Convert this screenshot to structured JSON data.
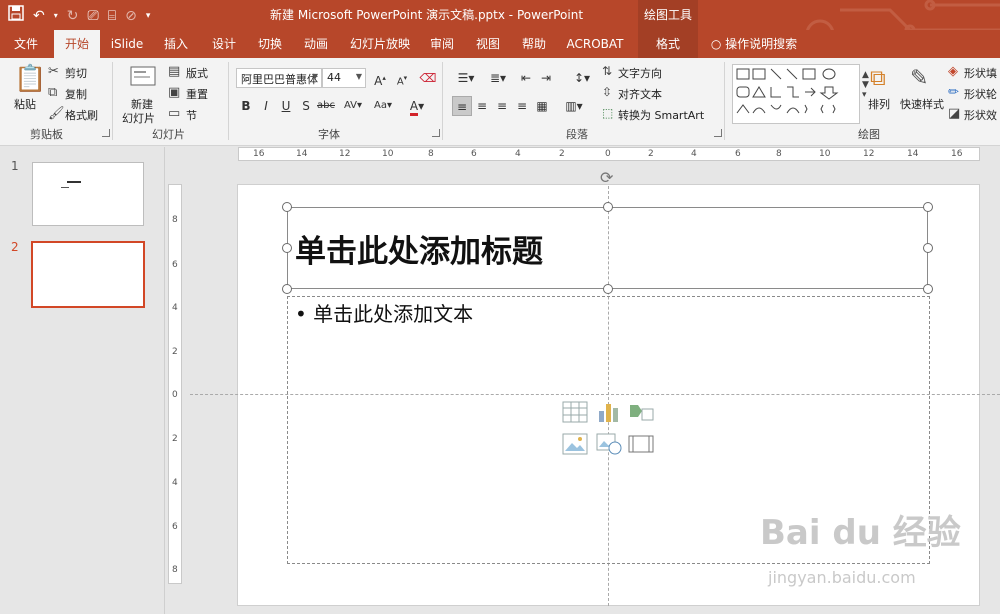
{
  "window": {
    "title": "新建 Microsoft PowerPoint 演示文稿.pptx  -  PowerPoint",
    "context_tool": "绘图工具"
  },
  "tabs": [
    {
      "label": "文件"
    },
    {
      "label": "开始"
    },
    {
      "label": "iSlide"
    },
    {
      "label": "插入"
    },
    {
      "label": "设计"
    },
    {
      "label": "切换"
    },
    {
      "label": "动画"
    },
    {
      "label": "幻灯片放映"
    },
    {
      "label": "审阅"
    },
    {
      "label": "视图"
    },
    {
      "label": "帮助"
    },
    {
      "label": "ACROBAT"
    },
    {
      "label": "格式"
    }
  ],
  "tell_me": "操作说明搜索",
  "ribbon": {
    "clipboard": {
      "paste": "粘贴",
      "cut": "剪切",
      "copy": "复制",
      "format_painter": "格式刷",
      "label": "剪贴板"
    },
    "slides": {
      "new_slide_1": "新建",
      "new_slide_2": "幻灯片",
      "layout": "版式",
      "reset": "重置",
      "section": "节",
      "label": "幻灯片"
    },
    "font": {
      "font_name": "阿里巴巴普惠体",
      "font_size": "44",
      "label": "字体"
    },
    "paragraph": {
      "text_direction": "文字方向",
      "align_text": "对齐文本",
      "convert_smartart": "转换为 SmartArt",
      "label": "段落"
    },
    "drawing": {
      "arrange": "排列",
      "quick_styles": "快速样式",
      "shape_fill": "形状填",
      "shape_outline": "形状轮",
      "shape_effects": "形状效",
      "label": "绘图"
    }
  },
  "slides_panel": [
    {
      "number": "1"
    },
    {
      "number": "2"
    }
  ],
  "ruler": {
    "horizontal": [
      "16",
      "14",
      "12",
      "10",
      "8",
      "6",
      "4",
      "2",
      "0",
      "2",
      "4",
      "6",
      "8",
      "10",
      "12",
      "14",
      "16"
    ],
    "vertical": [
      "8",
      "6",
      "4",
      "2",
      "0",
      "2",
      "4",
      "6",
      "8"
    ]
  },
  "slide": {
    "title_placeholder": "单击此处添加标题",
    "body_placeholder": "• 单击此处添加文本"
  },
  "watermark": {
    "brand": "Bai du 经验",
    "url": "jingyan.baidu.com"
  },
  "colors": {
    "accent": "#b7472a",
    "selected_thumb": "#d24726"
  }
}
